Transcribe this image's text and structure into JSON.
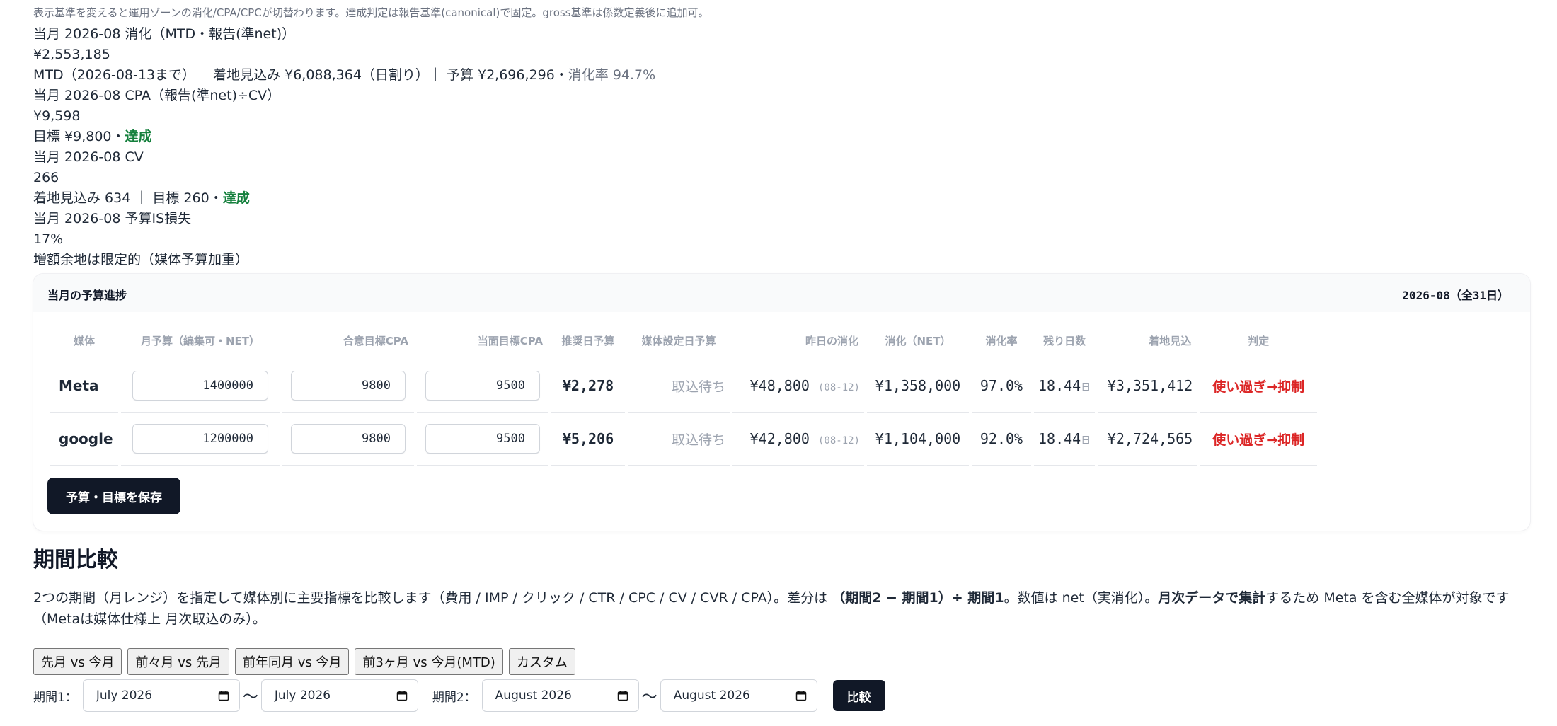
{
  "note": "表示基準を変えると運用ゾーンの消化/CPA/CPCが切替わります。達成判定は報告基準(canonical)で固定。gross基準は係数定義後に追加可。",
  "kpis": {
    "spend": {
      "label": "当月 2026-08 消化（MTD・報告(準net)）",
      "value": "¥2,553,185",
      "detail": "MTD（2026-08-13まで）｜ 着地見込み ¥6,088,364（日割り）｜ 予算 ¥2,696,296・",
      "rate": "消化率 94.7%"
    },
    "cpa": {
      "label": "当月 2026-08 CPA（報告(準net)÷CV）",
      "value": "¥9,598",
      "detail": "目標 ¥9,800・",
      "status": "達成"
    },
    "cv": {
      "label": "当月 2026-08 CV",
      "value": "266",
      "detail": "着地見込み 634 ｜ 目標 260・",
      "status": "達成"
    },
    "is_loss": {
      "label": "当月 2026-08 予算IS損失",
      "value": "17%",
      "detail": "増額余地は限定的（媒体予算加重）"
    }
  },
  "budget_panel": {
    "title": "当月の予算進捗",
    "month": "2026-08（全31日）",
    "headers": [
      "媒体",
      "月予算（編集可・NET）",
      "合意目標CPA",
      "当面目標CPA",
      "推奨日予算",
      "媒体設定日予算",
      "昨日の消化",
      "消化（NET）",
      "消化率",
      "残り日数",
      "着地見込",
      "判定"
    ],
    "rows": [
      {
        "media": "Meta",
        "budget": "1400000",
        "agreed_cpa": "9800",
        "current_cpa": "9500",
        "rec_daily": "¥2,278",
        "media_daily": "取込待ち",
        "yesterday": "¥48,800",
        "yesterday_date": "(08-12)",
        "spend": "¥1,358,000",
        "rate": "97.0%",
        "days": "18.44",
        "day_unit": "日",
        "landing": "¥3,351,412",
        "verdict": "使い過ぎ→抑制"
      },
      {
        "media": "google",
        "budget": "1200000",
        "agreed_cpa": "9800",
        "current_cpa": "9500",
        "rec_daily": "¥5,206",
        "media_daily": "取込待ち",
        "yesterday": "¥42,800",
        "yesterday_date": "(08-12)",
        "spend": "¥1,104,000",
        "rate": "92.0%",
        "days": "18.44",
        "day_unit": "日",
        "landing": "¥2,724,565",
        "verdict": "使い過ぎ→抑制"
      }
    ],
    "save_label": "予算・目標を保存"
  },
  "compare": {
    "title": "期間比較",
    "desc_1": "2つの期間（月レンジ）を指定して媒体別に主要指標を比較します（費用 / IMP / クリック / CTR / CPC / CV / CVR / CPA）。差分は ",
    "desc_2": "（期間2 − 期間1）÷ 期間1",
    "desc_3": "。数値は net（実消化）。",
    "desc_4": "月次データで集計",
    "desc_5": "するため Meta を含む全媒体が対象です（Metaは媒体仕様上 月次取込のみ）。",
    "presets": [
      "先月 vs 今月",
      "前々月 vs 先月",
      "前年同月 vs 今月",
      "前3ヶ月 vs 今月(MTD)",
      "カスタム"
    ],
    "period1_label": "期間1：",
    "period1_from": "July 2026",
    "period1_to": "July 2026",
    "period2_label": "期間2：",
    "period2_from": "August 2026",
    "period2_to": "August 2026",
    "tilde": "〜",
    "compare_label": "比較"
  }
}
